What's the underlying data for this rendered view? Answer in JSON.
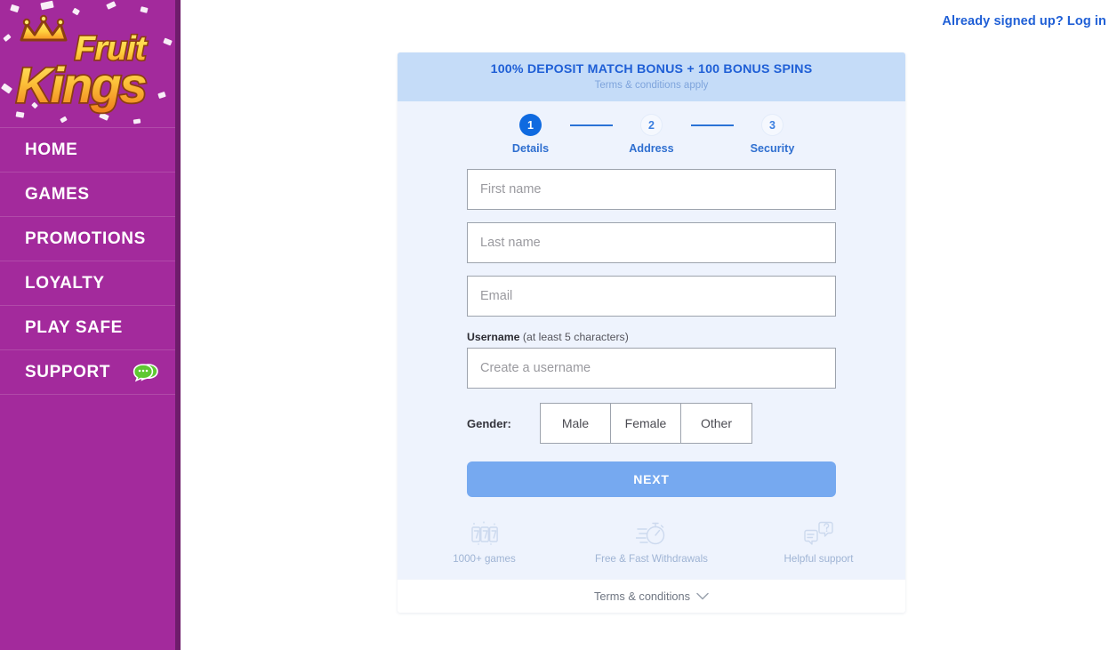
{
  "sidebar": {
    "logo": {
      "line1": "Fruit",
      "line2": "Kings",
      "alt": "FruitKings logo"
    },
    "items": [
      {
        "label": "HOME",
        "name": "home"
      },
      {
        "label": "GAMES",
        "name": "games"
      },
      {
        "label": "PROMOTIONS",
        "name": "promotions"
      },
      {
        "label": "LOYALTY",
        "name": "loyalty"
      },
      {
        "label": "PLAY SAFE",
        "name": "play-safe"
      },
      {
        "label": "SUPPORT",
        "name": "support",
        "icon": "chat-bubble-icon"
      }
    ],
    "colors": {
      "background": "#a32a9c",
      "edge": "#6e1c6b",
      "divider": "#b14aa9",
      "chat_icon": "#5ec832"
    }
  },
  "header": {
    "login_link": "Already signed up? Log in",
    "login_link_color": "#1f5fd6"
  },
  "card": {
    "banner": {
      "title": "100% DEPOSIT MATCH BONUS + 100 BONUS SPINS",
      "subtitle": "Terms & conditions apply",
      "background": "#c5dcf8",
      "title_color": "#1f5fd6",
      "subtitle_color": "#7ea4dc"
    },
    "stepper": {
      "steps": [
        {
          "number": "1",
          "label": "Details",
          "state": "active"
        },
        {
          "number": "2",
          "label": "Address",
          "state": "inactive"
        },
        {
          "number": "3",
          "label": "Security",
          "state": "inactive"
        }
      ],
      "active_color": "#0f6ae0",
      "line_color": "#2a72d6"
    },
    "form": {
      "first_name": {
        "placeholder": "First name",
        "value": ""
      },
      "last_name": {
        "placeholder": "Last name",
        "value": ""
      },
      "email": {
        "placeholder": "Email",
        "value": ""
      },
      "username": {
        "label_strong": "Username",
        "label_hint": " (at least 5 characters)",
        "placeholder": "Create a username",
        "value": ""
      },
      "gender": {
        "label": "Gender:",
        "options": [
          "Male",
          "Female",
          "Other"
        ],
        "selected": ""
      },
      "next_button": {
        "label": "NEXT",
        "color": "#76a9f0"
      }
    },
    "features": [
      {
        "label": "1000+ games",
        "icon": "slot-777-icon"
      },
      {
        "label": "Free & Fast Withdrawals",
        "icon": "stopwatch-icon"
      },
      {
        "label": "Helpful support",
        "icon": "support-chat-icon"
      }
    ],
    "terms": {
      "label": "Terms & conditions",
      "icon": "chevron-down-icon"
    },
    "colors": {
      "body": "#eef3fd",
      "footer": "#ffffff"
    }
  }
}
